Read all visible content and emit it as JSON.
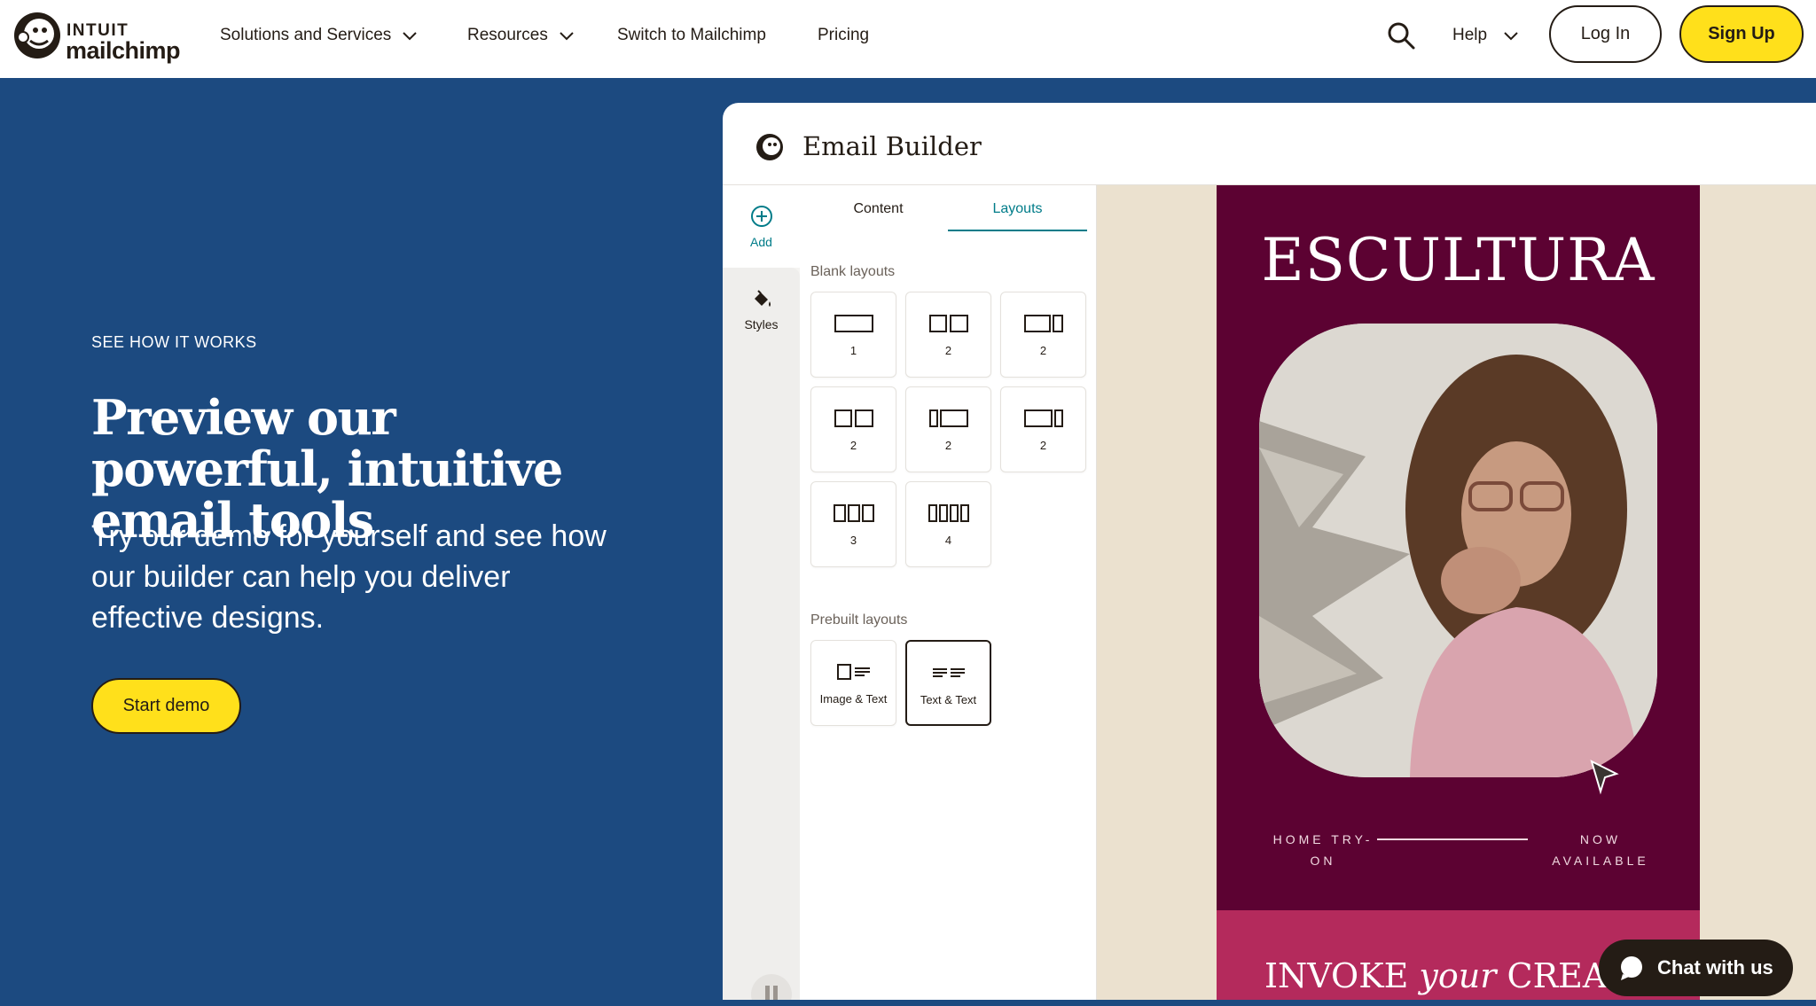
{
  "nav": {
    "logo_intuit": "INTUIT",
    "logo_mailchimp": "mailchimp",
    "items": [
      {
        "label": "Solutions and Services",
        "has_dropdown": true
      },
      {
        "label": "Resources",
        "has_dropdown": true
      },
      {
        "label": "Switch to Mailchimp",
        "has_dropdown": false
      },
      {
        "label": "Pricing",
        "has_dropdown": false
      }
    ],
    "search_icon": "search-icon",
    "help_label": "Help",
    "login_label": "Log In",
    "signup_label": "Sign Up"
  },
  "hero": {
    "eyebrow": "SEE HOW IT WORKS",
    "headline": "Preview our powerful, intuitive email tools",
    "subtext": "Try our demo for yourself and see how our builder can help you deliver effective designs.",
    "cta_label": "Start demo"
  },
  "builder": {
    "title": "Email Builder",
    "rail": {
      "add_label": "Add",
      "styles_label": "Styles"
    },
    "tabs": [
      {
        "label": "Content",
        "active": false
      },
      {
        "label": "Layouts",
        "active": true
      }
    ],
    "blank_section_label": "Blank layouts",
    "blank_layouts": [
      {
        "caption": "1"
      },
      {
        "caption": "2"
      },
      {
        "caption": "2"
      },
      {
        "caption": "2"
      },
      {
        "caption": "2"
      },
      {
        "caption": "2"
      },
      {
        "caption": "3"
      },
      {
        "caption": "4"
      }
    ],
    "prebuilt_section_label": "Prebuilt layouts",
    "prebuilt_layouts": [
      {
        "caption": "Image & Text",
        "selected": false
      },
      {
        "caption": "Text & Text",
        "selected": true
      }
    ]
  },
  "email_preview": {
    "brand": "ESCULTURA",
    "footer_left": "HOME TRY-ON",
    "footer_right": "NOW AVAILABLE",
    "band_text_1": "INVOKE",
    "band_text_2": "your",
    "band_text_3": "CREATI"
  },
  "chat": {
    "label": "Chat with us"
  },
  "colors": {
    "hero_bg": "#1c4a80",
    "accent_yellow": "#ffe01b",
    "teal_active": "#007c89",
    "email_bg": "#5c0232",
    "email_band": "#b42a5c",
    "canvas_bg": "#ebe1cf"
  }
}
